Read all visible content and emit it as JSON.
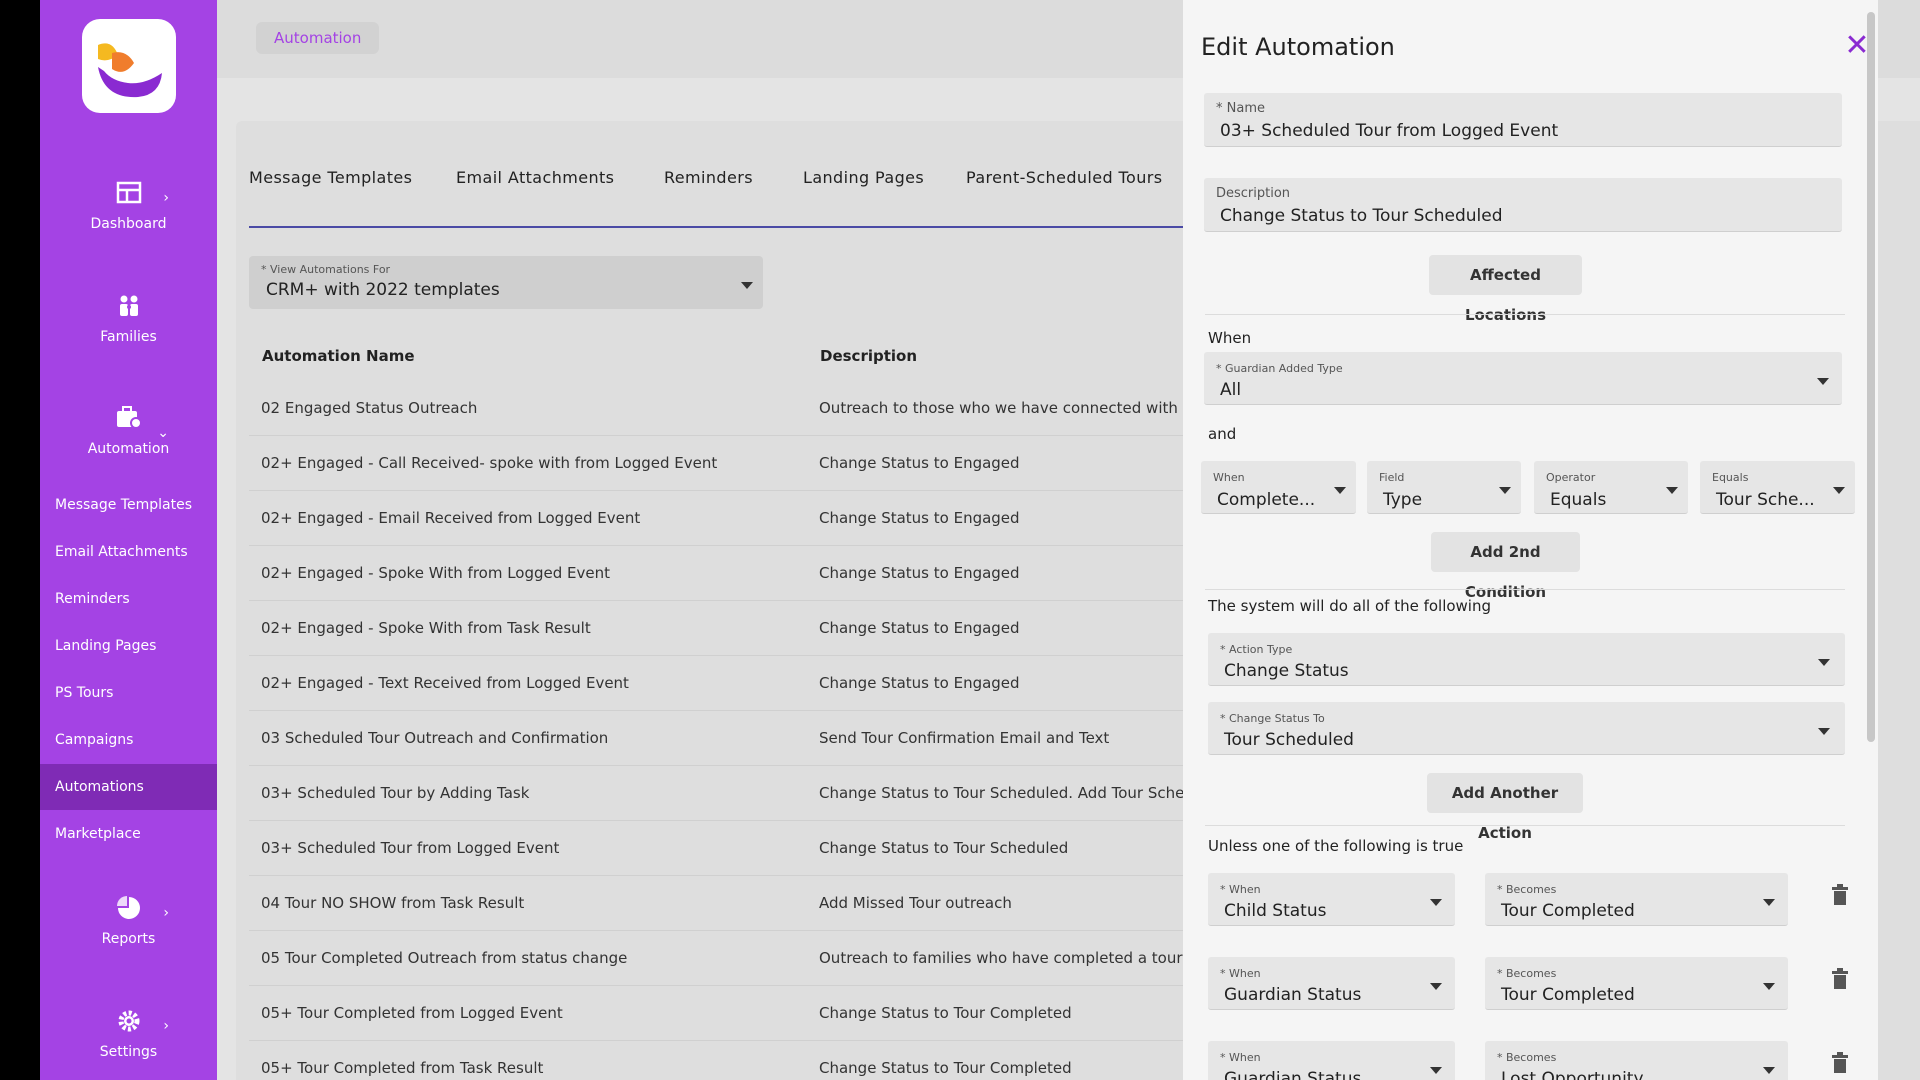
{
  "sidebar": {
    "nav": [
      {
        "label": "Dashboard",
        "icon": "dashboard-icon"
      },
      {
        "label": "Families",
        "icon": "families-icon"
      },
      {
        "label": "Automation",
        "icon": "automation-icon"
      },
      {
        "label": "Reports",
        "icon": "reports-icon"
      },
      {
        "label": "Settings",
        "icon": "gear-icon"
      }
    ],
    "sub_items": [
      {
        "label": "Message Templates"
      },
      {
        "label": "Email Attachments"
      },
      {
        "label": "Reminders"
      },
      {
        "label": "Landing Pages"
      },
      {
        "label": "PS Tours"
      },
      {
        "label": "Campaigns"
      },
      {
        "label": "Automations",
        "active": true
      },
      {
        "label": "Marketplace"
      }
    ]
  },
  "header": {
    "breadcrumb": "Automation"
  },
  "tabs": [
    "Message Templates",
    "Email Attachments",
    "Reminders",
    "Landing Pages",
    "Parent-Scheduled Tours"
  ],
  "view_select": {
    "label": "* View Automations For",
    "value": "CRM+ with 2022 templates"
  },
  "table": {
    "columns": [
      "Automation Name",
      "Description"
    ],
    "rows": [
      {
        "name": "02 Engaged Status Outreach",
        "description": "Outreach to those who we have connected with but"
      },
      {
        "name": "02+ Engaged - Call Received- spoke with from Logged Event",
        "description": "Change Status to Engaged"
      },
      {
        "name": "02+ Engaged - Email Received from Logged Event",
        "description": "Change Status to Engaged"
      },
      {
        "name": "02+ Engaged - Spoke With from Logged Event",
        "description": "Change Status to Engaged"
      },
      {
        "name": "02+ Engaged - Spoke With from Task Result",
        "description": "Change Status to Engaged"
      },
      {
        "name": "02+ Engaged - Text Received from Logged Event",
        "description": "Change Status to Engaged"
      },
      {
        "name": "03 Scheduled Tour Outreach and Confirmation",
        "description": "Send Tour Confirmation Email and Text"
      },
      {
        "name": "03+ Scheduled Tour by Adding Task",
        "description": "Change Status to Tour Scheduled. Add Tour Schedu"
      },
      {
        "name": "03+ Scheduled Tour from Logged Event",
        "description": "Change Status to Tour Scheduled"
      },
      {
        "name": "04 Tour NO SHOW from Task Result",
        "description": "Add Missed Tour outreach"
      },
      {
        "name": "05 Tour Completed Outreach from status change",
        "description": "Outreach to families who have completed a tour but"
      },
      {
        "name": "05+ Tour Completed from Logged Event",
        "description": "Change Status to Tour Completed"
      },
      {
        "name": "05+ Tour Completed from Task Result",
        "description": "Change Status to Tour Completed"
      }
    ]
  },
  "drawer": {
    "title": "Edit Automation",
    "name": {
      "label": "* Name",
      "value": "03+ Scheduled Tour from Logged Event"
    },
    "description": {
      "label": "Description",
      "value": "Change Status to Tour Scheduled"
    },
    "affected_locations_button": "Affected Locations",
    "when_label": "When",
    "guardian_added_type": {
      "label": "* Guardian Added Type",
      "value": "All"
    },
    "and_label": "and",
    "conditions": [
      {
        "label": "When",
        "value": "Complete..."
      },
      {
        "label": "Field",
        "value": "Type"
      },
      {
        "label": "Operator",
        "value": "Equals"
      },
      {
        "label": "Equals",
        "value": "Tour Sche..."
      }
    ],
    "add_condition_button": "Add 2nd Condition",
    "actions_label": "The system will do all of the following",
    "action_type": {
      "label": "* Action Type",
      "value": "Change Status"
    },
    "change_status_to": {
      "label": "* Change Status To",
      "value": "Tour Scheduled"
    },
    "add_action_button": "Add Another Action",
    "unless_label": "Unless one of the following is true",
    "exceptions": [
      {
        "when_label": "* When",
        "when": "Child Status",
        "becomes_label": "* Becomes",
        "becomes": "Tour Completed"
      },
      {
        "when_label": "* When",
        "when": "Guardian Status",
        "becomes_label": "* Becomes",
        "becomes": "Tour Completed"
      },
      {
        "when_label": "* When",
        "when": "Guardian Status",
        "becomes_label": "* Becomes",
        "becomes": "Lost Opportunity"
      }
    ]
  },
  "colors": {
    "brand": "#a443e4",
    "active": "#7f2bb5",
    "close": "#8a2ad1"
  }
}
